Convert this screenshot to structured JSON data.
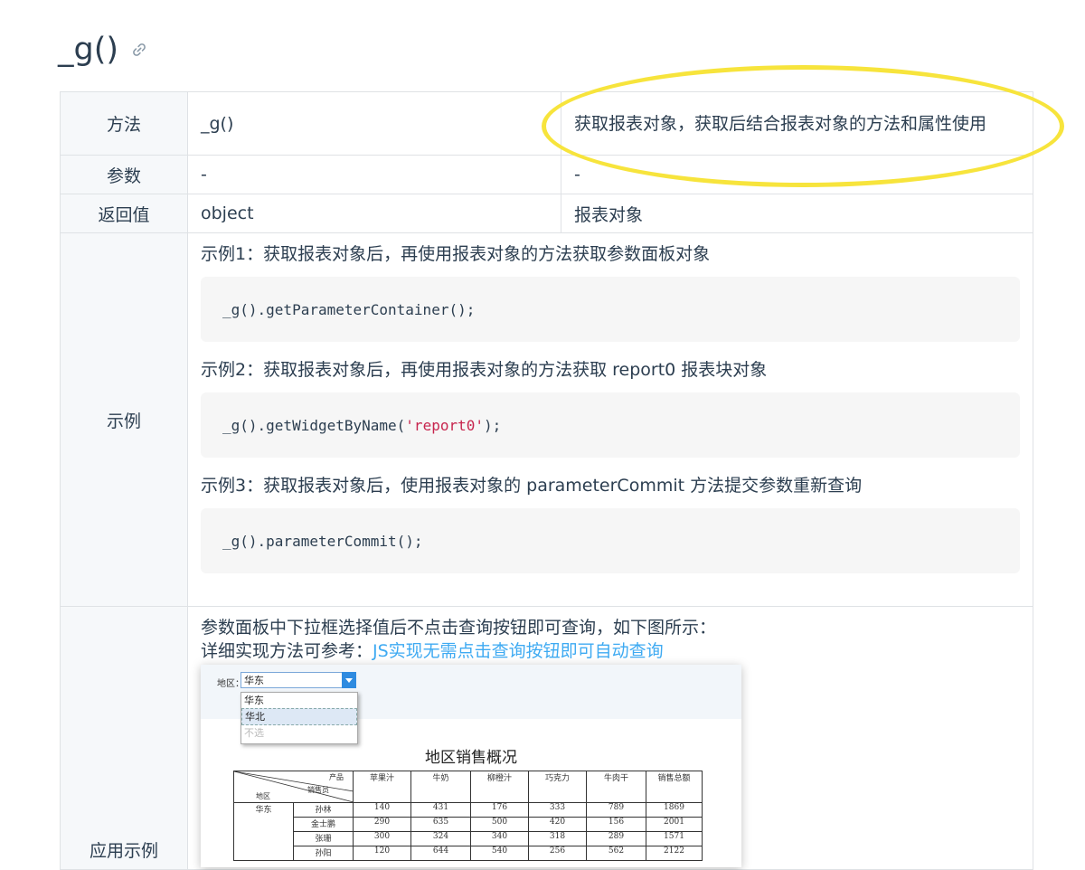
{
  "heading": "_g()",
  "table": {
    "method": {
      "key": "方法",
      "value": "_g()",
      "desc": "获取报表对象，获取后结合报表对象的方法和属性使用"
    },
    "param": {
      "key": "参数",
      "value": "-",
      "desc": "-"
    },
    "return": {
      "key": "返回值",
      "value": "object",
      "desc": "报表对象"
    },
    "example": {
      "key": "示例",
      "items": [
        {
          "title": "示例1：获取报表对象后，再使用报表对象的方法获取参数面板对象",
          "code": "_g().getParameterContainer();"
        },
        {
          "title": "示例2：获取报表对象后，再使用报表对象的方法获取 report0 报表块对象",
          "code_pre": "_g().getWidgetByName(",
          "code_str": "'report0'",
          "code_post": ");"
        },
        {
          "title": "示例3：获取报表对象后，使用报表对象的 parameterCommit 方法提交参数重新查询",
          "code": "_g().parameterCommit();"
        }
      ]
    },
    "application": {
      "key": "应用示例",
      "line1": "参数面板中下拉框选择值后不点击查询按钮即可查询，如下图所示：",
      "line2_prefix": "详细实现方法可参考：",
      "line2_link": "JS实现无需点击查询按钮即可自动查询"
    }
  },
  "report_screenshot": {
    "filter_label": "地区：",
    "selected": "华东",
    "options": [
      "华东",
      "华北",
      "不选"
    ],
    "hovered_option": "华北",
    "title": "地区销售概况",
    "header_corner": {
      "top": "产品",
      "middle": "销售员",
      "bottom": "地区"
    },
    "columns": [
      "苹果汁",
      "牛奶",
      "柳橙汁",
      "巧克力",
      "牛肉干",
      "销售总额"
    ],
    "region": "华东",
    "rows": [
      {
        "name": "孙林",
        "values": [
          "140",
          "431",
          "176",
          "333",
          "789",
          "1869"
        ]
      },
      {
        "name": "金士鹏",
        "values": [
          "290",
          "635",
          "500",
          "420",
          "156",
          "2001"
        ]
      },
      {
        "name": "张珊",
        "values": [
          "300",
          "324",
          "340",
          "318",
          "289",
          "1571"
        ]
      },
      {
        "name": "孙阳",
        "values": [
          "120",
          "644",
          "540",
          "256",
          "562",
          "2122"
        ]
      }
    ]
  },
  "colors": {
    "highlight_ellipse": "#f7e43c",
    "link": "#3eaaf2",
    "code_string": "#c7254e"
  }
}
